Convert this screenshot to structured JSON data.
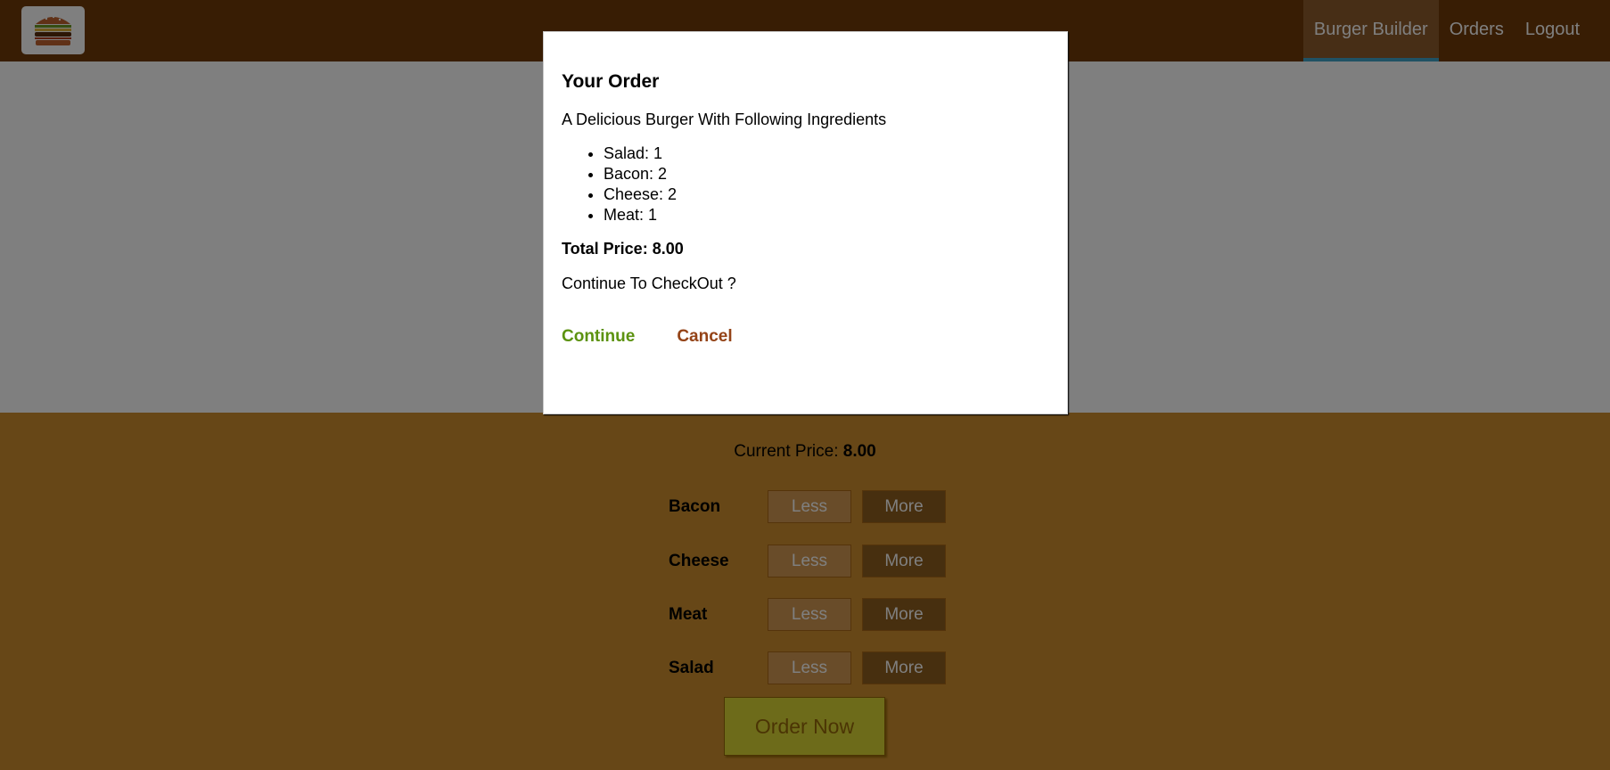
{
  "toolbar": {
    "logo_icon": "burger-logo-icon",
    "nav": [
      {
        "label": "Burger Builder",
        "active": true
      },
      {
        "label": "Orders",
        "active": false
      },
      {
        "label": "Logout",
        "active": false
      }
    ]
  },
  "controls": {
    "price_label": "Current Price:",
    "price_value": "8.00",
    "items": [
      {
        "label": "Bacon",
        "less": "Less",
        "more": "More"
      },
      {
        "label": "Cheese",
        "less": "Less",
        "more": "More"
      },
      {
        "label": "Meat",
        "less": "Less",
        "more": "More"
      },
      {
        "label": "Salad",
        "less": "Less",
        "more": "More"
      }
    ],
    "order_button": "Order Now"
  },
  "modal": {
    "title": "Your Order",
    "subtitle": "A Delicious Burger With Following Ingredients",
    "ingredients": [
      "Salad: 1",
      "Bacon: 2",
      "Cheese: 2",
      "Meat: 1"
    ],
    "total": "Total Price: 8.00",
    "question": "Continue To CheckOut ?",
    "continue_label": "Continue",
    "cancel_label": "Cancel"
  },
  "colors": {
    "toolbar": "#703b09",
    "controls": "#cf8f2e",
    "continue": "#5c9210",
    "cancel": "#944317",
    "active_border": "#40a4c8"
  }
}
